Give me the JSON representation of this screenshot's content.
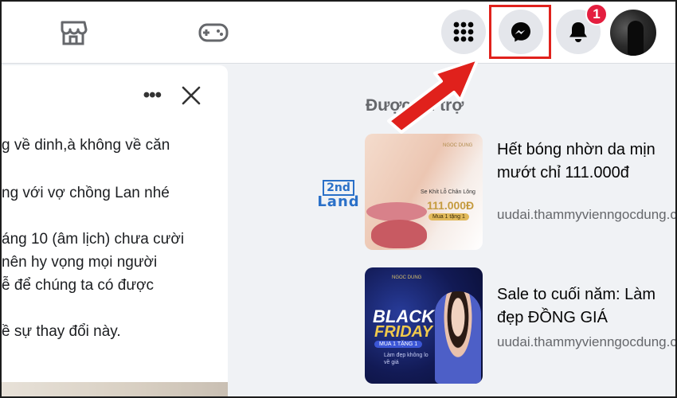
{
  "topbar": {
    "tabs": [
      {
        "name": "marketplace",
        "icon": "store-icon"
      },
      {
        "name": "gaming",
        "icon": "gamepad-icon"
      }
    ],
    "menu_icon": "grid-menu-icon",
    "messenger_icon": "messenger-icon",
    "notifications": {
      "icon": "bell-icon",
      "badge": "1"
    },
    "highlight_color": "#e0211c",
    "accent_color": "#e41e3f"
  },
  "post": {
    "lines": [
      "g về dinh,à không về căn",
      "ng với vợ chồng Lan nhé",
      "áng 10 (âm lịch) chưa cười",
      " nên hy vọng mọi người",
      "ễ để chúng ta có được",
      "ề sự thay đổi này."
    ]
  },
  "sponsored": {
    "title": "Được tài trợ",
    "ads": [
      {
        "title": "Hết bóng nhờn da mịn mướt chỉ 111.000đ",
        "url": "uudai.thammyvienngocdung.com",
        "image": {
          "brand": "NGOC DUNG",
          "caption": "Se Khít Lỗ Chân Lông",
          "price": "111.000Đ",
          "pill": "Mua 1 tặng 1"
        }
      },
      {
        "title": "Sale to cuối năm: Làm đẹp ĐỒNG GIÁ",
        "url": "uudai.thammyvienngocdung.com",
        "image": {
          "brand": "NGOC DUNG",
          "line1": "BLACK",
          "line2": "FRIDAY",
          "pill": "MUA 1 TẶNG 1",
          "note": "Làm đẹp không lo về giá"
        }
      }
    ]
  },
  "watermark": {
    "top": "2nd",
    "bottom": "Land"
  }
}
